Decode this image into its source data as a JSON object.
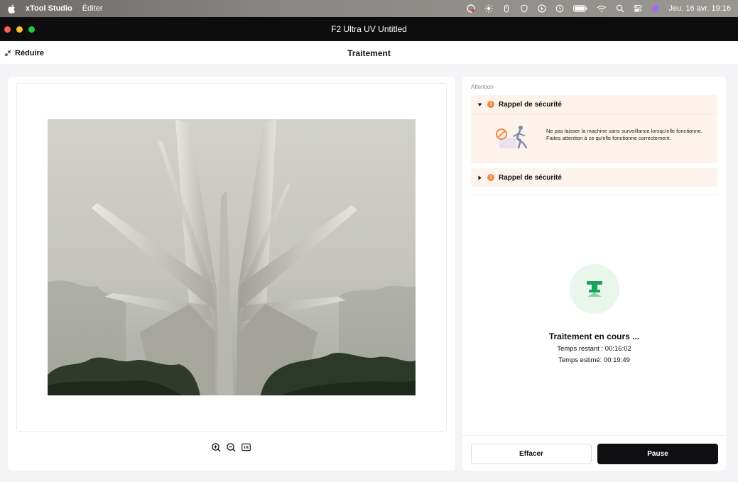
{
  "menubar": {
    "app_name": "xTool Studio",
    "menu_items": [
      "Éditer"
    ],
    "status_icons": [
      "creative-cloud-icon",
      "brightness-icon",
      "shield-icon",
      "shield-outline-icon",
      "play-circle-icon",
      "time-machine-icon",
      "battery-icon",
      "wifi-icon",
      "spotlight-search-icon",
      "control-center-icon",
      "siri-icon"
    ],
    "clock": "Jeu. 16 avr.  19:16"
  },
  "window": {
    "title": "F2 Ultra UV Untitled"
  },
  "header": {
    "reduce_label": "Réduire",
    "title": "Traitement"
  },
  "right_panel": {
    "attention_label": "Attention",
    "accordions": [
      {
        "title": "Rappel de sécurité",
        "expanded": true,
        "message": "Ne pas laisser la machine sans surveillance lorsqu'elle fonctionne. Faites attention à ce qu'elle fonctionne correctement."
      },
      {
        "title": "Rappel de sécurité",
        "expanded": false
      }
    ],
    "status": {
      "title": "Traitement en cours ...",
      "remaining": "Temps restant :  00:16:02",
      "estimated": "Temps estimé:  00:19:49"
    },
    "buttons": {
      "clear": "Effacer",
      "pause": "Pause"
    }
  },
  "colors": {
    "accent_green": "#18a55a",
    "warning_orange": "#f08a3c",
    "accordion_bg": "#fdf3ec",
    "pause_bg": "#0f0f12"
  }
}
